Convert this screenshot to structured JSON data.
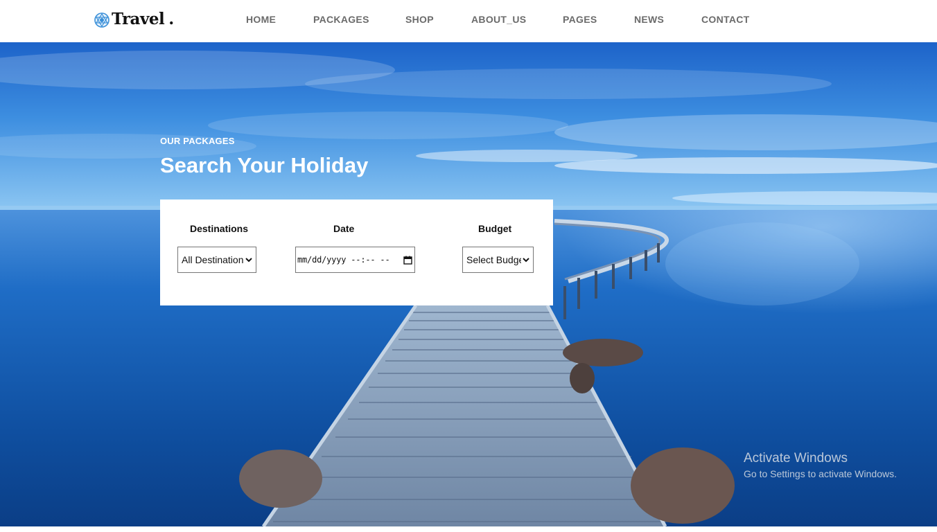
{
  "brand": {
    "name": "Travel",
    "dot": ".",
    "icon": "globe-icon"
  },
  "nav": {
    "items": [
      {
        "label": "HOME"
      },
      {
        "label": "PACKAGES"
      },
      {
        "label": "SHOP"
      },
      {
        "label": "ABOUT_US"
      },
      {
        "label": "PAGES"
      },
      {
        "label": "NEWS"
      },
      {
        "label": "CONTACT"
      }
    ]
  },
  "hero": {
    "eyebrow": "OUR PACKAGES",
    "title": "Search Your Holiday",
    "background": "lake-pier-photo"
  },
  "search": {
    "destinations": {
      "label": "Destinations",
      "value": "All Destinations"
    },
    "date": {
      "label": "Date",
      "value": "mm/dd/yyyy  --:-- --"
    },
    "budget": {
      "label": "Budget",
      "value": "Select Budget"
    }
  },
  "watermark": {
    "title": "Activate Windows",
    "subtitle": "Go to Settings to activate Windows."
  },
  "colors": {
    "nav_text": "#6b6b6b",
    "sky": "#2f7fd6",
    "water": "#1a5fb4"
  }
}
